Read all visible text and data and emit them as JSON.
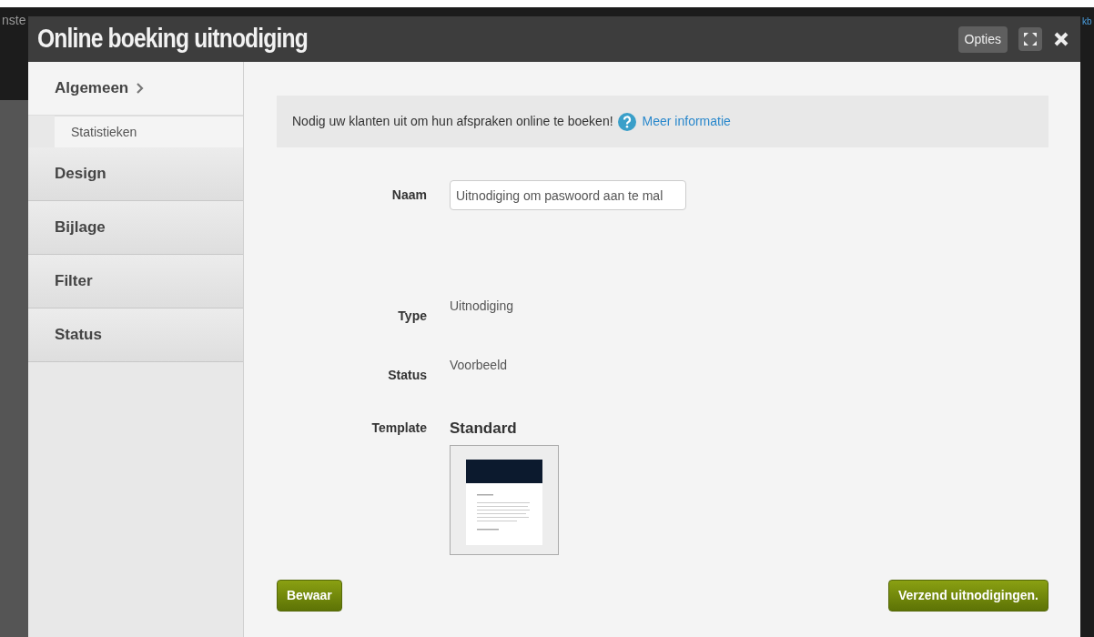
{
  "background": {
    "left_tab": "nste",
    "right_tab": "kb"
  },
  "window": {
    "title": "Online boeking uitnodiging",
    "options_button": "Opties"
  },
  "sidebar": {
    "items": [
      {
        "label": "Algemeen",
        "selected": true,
        "children": [
          {
            "label": "Statistieken",
            "selected": false
          }
        ]
      },
      {
        "label": "Design",
        "selected": false
      },
      {
        "label": "Bijlage",
        "selected": false
      },
      {
        "label": "Filter",
        "selected": false
      },
      {
        "label": "Status",
        "selected": false
      }
    ]
  },
  "info": {
    "text": "Nodig uw klanten uit om hun afspraken online te boeken!",
    "link": "Meer informatie"
  },
  "form": {
    "name": {
      "label": "Naam",
      "value": "Uitnodiging om paswoord aan te mal"
    },
    "fields": [
      {
        "label": "Type",
        "value": "Uitnodiging"
      },
      {
        "label": "Status",
        "value": "Voorbeeld"
      }
    ],
    "template": {
      "label": "Template",
      "name": "Standard"
    }
  },
  "buttons": {
    "save": "Bewaar",
    "send": "Verzend uitnodigingen."
  }
}
